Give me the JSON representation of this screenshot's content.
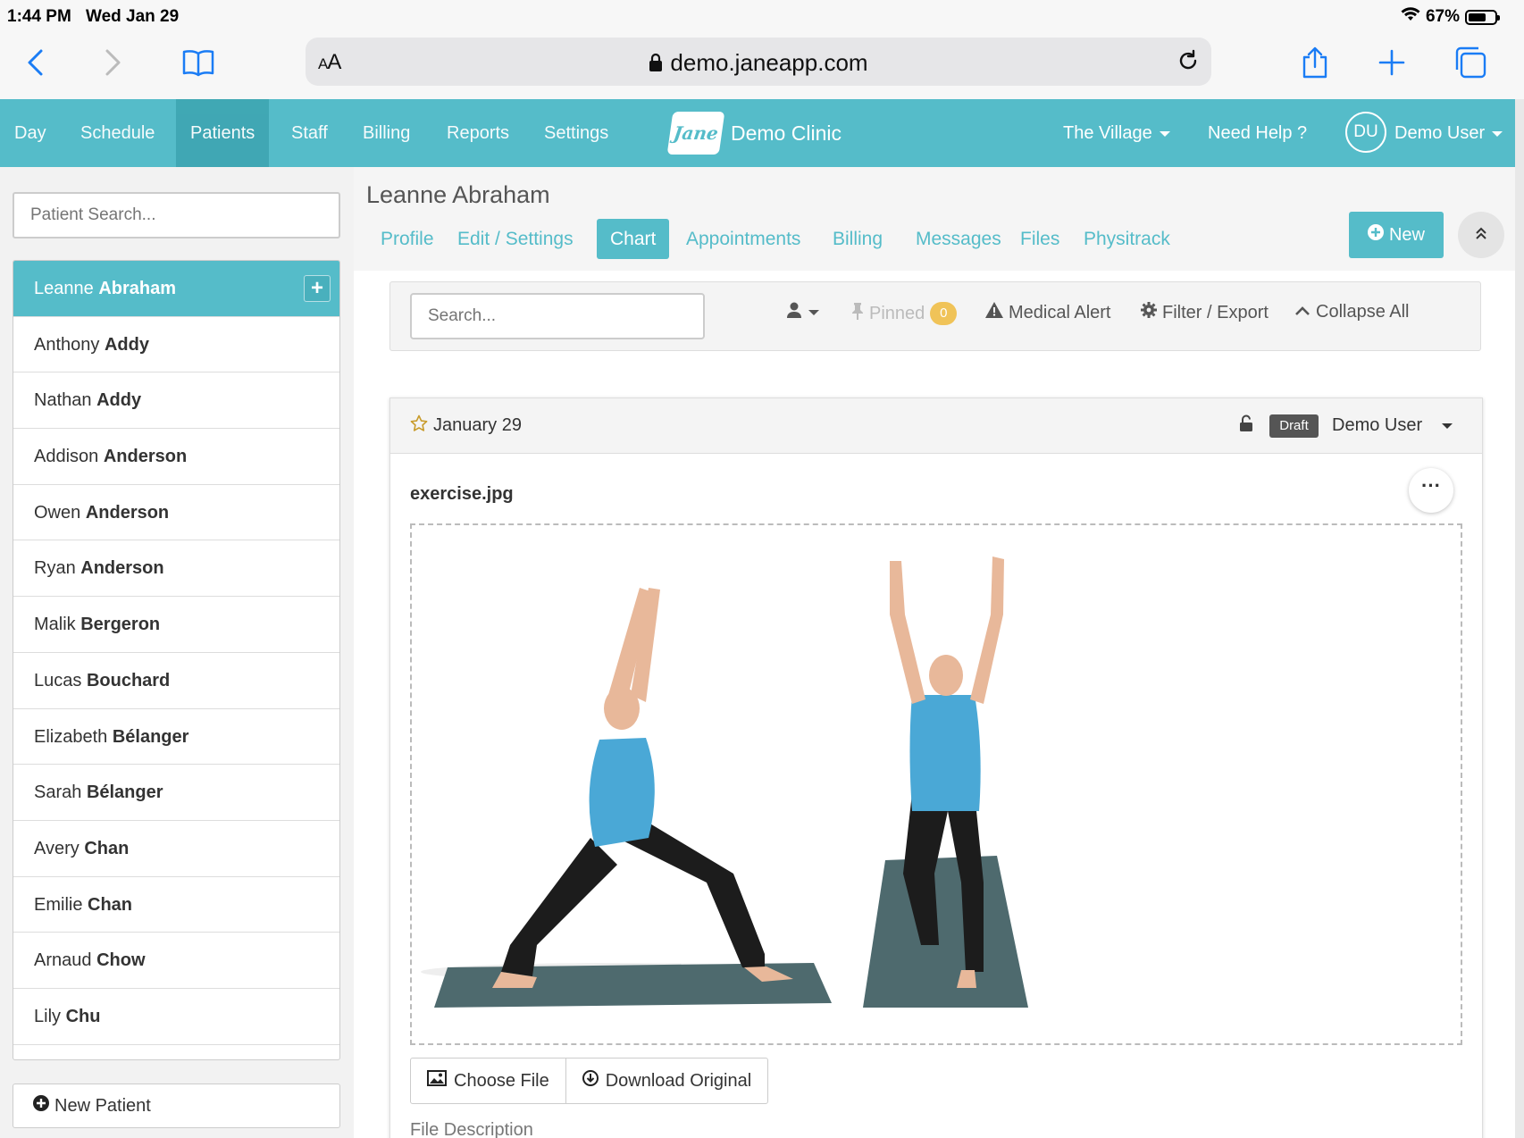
{
  "status_bar": {
    "time": "1:44 PM",
    "date": "Wed Jan 29",
    "battery": "67%"
  },
  "browser": {
    "text_size_label": "AA",
    "url": "demo.janeapp.com"
  },
  "app_nav": {
    "items": [
      "Day",
      "Schedule",
      "Patients",
      "Staff",
      "Billing",
      "Reports",
      "Settings"
    ],
    "active": "Patients",
    "logo_text": "Jane",
    "clinic_name": "Demo Clinic",
    "location": "The Village",
    "help": "Need Help ?",
    "user_initials": "DU",
    "user_name": "Demo User"
  },
  "sidebar": {
    "search_placeholder": "Patient Search...",
    "patients": [
      {
        "first": "Leanne",
        "last": "Abraham",
        "active": true
      },
      {
        "first": "Anthony",
        "last": "Addy"
      },
      {
        "first": "Nathan",
        "last": "Addy"
      },
      {
        "first": "Addison",
        "last": "Anderson"
      },
      {
        "first": "Owen",
        "last": "Anderson"
      },
      {
        "first": "Ryan",
        "last": "Anderson"
      },
      {
        "first": "Malik",
        "last": "Bergeron"
      },
      {
        "first": "Lucas",
        "last": "Bouchard"
      },
      {
        "first": "Elizabeth",
        "last": "Bélanger"
      },
      {
        "first": "Sarah",
        "last": "Bélanger"
      },
      {
        "first": "Avery",
        "last": "Chan"
      },
      {
        "first": "Emilie",
        "last": "Chan"
      },
      {
        "first": "Arnaud",
        "last": "Chow"
      },
      {
        "first": "Lily",
        "last": "Chu"
      }
    ],
    "new_patient": "New Patient"
  },
  "patient": {
    "name": "Leanne Abraham",
    "tabs": [
      "Profile",
      "Edit / Settings",
      "Chart",
      "Appointments",
      "Billing",
      "Messages",
      "Files",
      "Physitrack"
    ],
    "active_tab": "Chart",
    "new_button": "New"
  },
  "chart_toolbar": {
    "search_placeholder": "Search...",
    "pinned_label": "Pinned",
    "pinned_count": "0",
    "medical_alert": "Medical Alert",
    "filter_export": "Filter / Export",
    "collapse_all": "Collapse All"
  },
  "entry": {
    "date": "January 29",
    "status": "Draft",
    "author": "Demo User",
    "file_name": "exercise.jpg",
    "choose_file": "Choose File",
    "download_original": "Download Original",
    "file_description": "File Description"
  },
  "colors": {
    "brand": "#55bcc9",
    "brand_dark": "#3fa6b3",
    "pinned_badge": "#f0c358"
  }
}
